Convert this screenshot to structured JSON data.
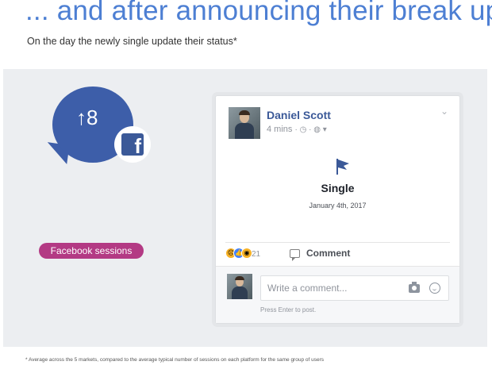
{
  "header": {
    "title": "... and after announcing their break up",
    "subtitle": "On the day the newly single update their status*"
  },
  "stat": {
    "value": "↑8",
    "label": "Facebook sessions",
    "icon": "facebook-logo-icon"
  },
  "post": {
    "author": "Daniel Scott",
    "time": "4 mins",
    "privacy_icon": "globe-icon",
    "status_icon": "flag-icon",
    "status": "Single",
    "date": "January 4th, 2017",
    "reactions": [
      "sad-reaction",
      "like-reaction",
      "wow-reaction"
    ],
    "reaction_count": "21",
    "comment_label": "Comment",
    "comment_placeholder": "Write a comment...",
    "press_enter_hint": "Press Enter to post."
  },
  "colors": {
    "headline": "#4d7fd3",
    "bubble": "#3d5ea9",
    "pill": "#b33a84",
    "facebook_blue": "#3b5998"
  },
  "footnote": "* Average across the 5 markets, compared to the average typical number of sessions on each platform for the same group of users"
}
